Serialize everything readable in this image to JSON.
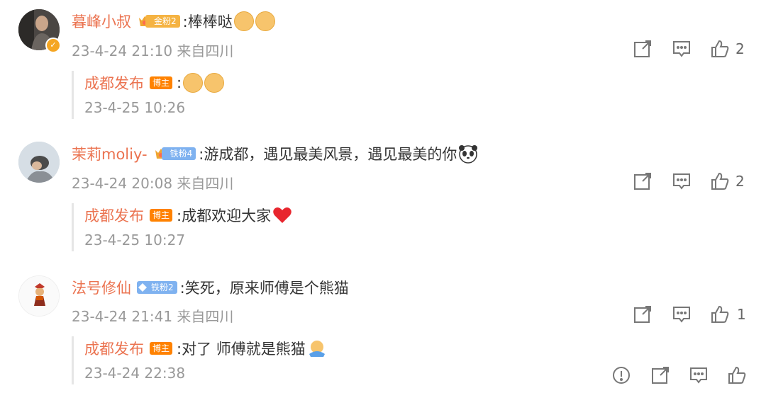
{
  "comments": [
    {
      "username": "暮峰小叔",
      "fan_badge": "金粉2",
      "text": ":棒棒哒",
      "emojis": [
        "emoji-1",
        "emoji-2"
      ],
      "meta": "23-4-24 21:10 来自四川",
      "like_count": "2",
      "reply": {
        "username": "成都发布",
        "badge": "博主",
        "text": ":",
        "meta": "23-4-25 10:26"
      }
    },
    {
      "username": "茉莉moliy-",
      "fan_badge": "铁粉4",
      "text": ":游成都，遇见最美风景，遇见最美的你",
      "meta": "23-4-24 20:08 来自四川",
      "like_count": "2",
      "reply": {
        "username": "成都发布",
        "badge": "博主",
        "text": ":成都欢迎大家",
        "meta": "23-4-25 10:27"
      }
    },
    {
      "username": "法号修仙",
      "fan_badge": "铁粉2",
      "text": ":笑死，原来师傅是个熊猫",
      "meta": "23-4-24 21:41 来自四川",
      "like_count": "1",
      "reply": {
        "username": "成都发布",
        "badge": "博主",
        "text": ":对了 师傅就是熊猫",
        "meta": "23-4-24 22:38"
      }
    }
  ],
  "icons": [
    "share-icon",
    "comment-icon",
    "like-icon",
    "report-icon"
  ],
  "colors": {
    "username": "#eb7350",
    "text": "#333333",
    "meta": "#999999",
    "bozhu": "#ff8200",
    "gold_fan": "#f5b342",
    "iron_fan": "#7fb2f0"
  }
}
